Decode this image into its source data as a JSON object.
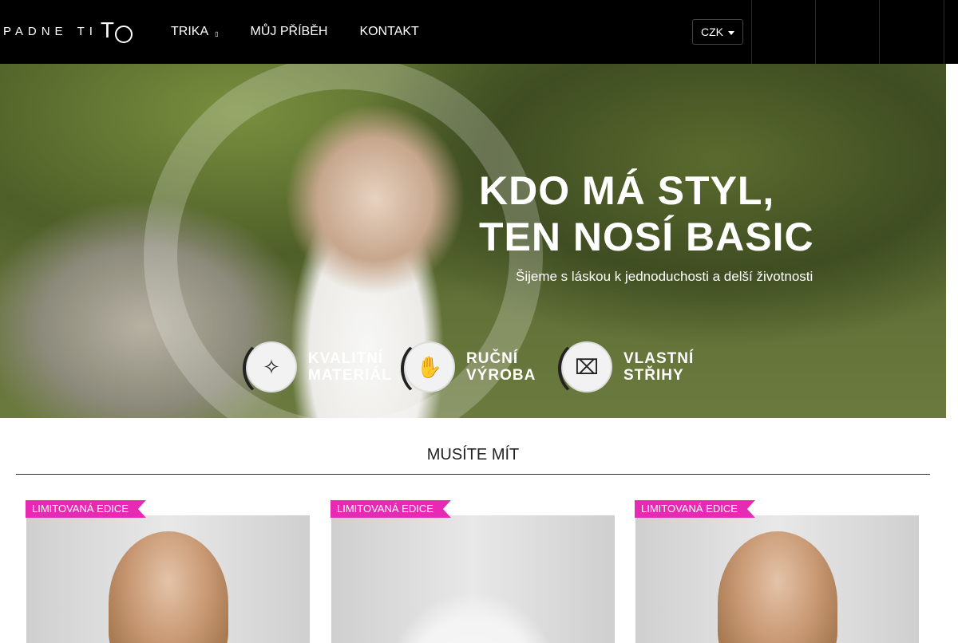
{
  "header": {
    "logo_text_1": "PADNE",
    "logo_text_2": "TI",
    "logo_mark": "TO",
    "nav": [
      {
        "label": "TRIKA",
        "has_dropdown": true
      },
      {
        "label": "MŮJ PŘÍBĚH",
        "has_dropdown": false
      },
      {
        "label": "KONTAKT",
        "has_dropdown": false
      }
    ],
    "currency": "CZK",
    "icons": [
      "user-icon",
      "heart-icon",
      "cart-icon"
    ],
    "icon_glyphs": [
      "",
      "",
      ""
    ]
  },
  "hero": {
    "headline_line1": "KDO MÁ STYL,",
    "headline_line2": "TEN NOSÍ BASIC",
    "subtitle": "Šijeme s láskou k jednoduchosti a delší životnosti",
    "features": [
      {
        "line1": "KVALITNÍ",
        "line2": "MATERIÁL",
        "icon": "fabric-icon"
      },
      {
        "line1": "RUČNÍ",
        "line2": "VÝROBA",
        "icon": "hand-icon"
      },
      {
        "line1": "VLASTNÍ",
        "line2": "STŘIHY",
        "icon": "sewing-machine-icon"
      }
    ]
  },
  "section": {
    "title": "MUSÍTE MÍT"
  },
  "products": [
    {
      "badge": "LIMITOVANÁ EDICE"
    },
    {
      "badge": "LIMITOVANÁ EDICE"
    },
    {
      "badge": "LIMITOVANÁ EDICE"
    }
  ],
  "colors": {
    "header_bg": "#000000",
    "badge": "#e62ab4"
  }
}
